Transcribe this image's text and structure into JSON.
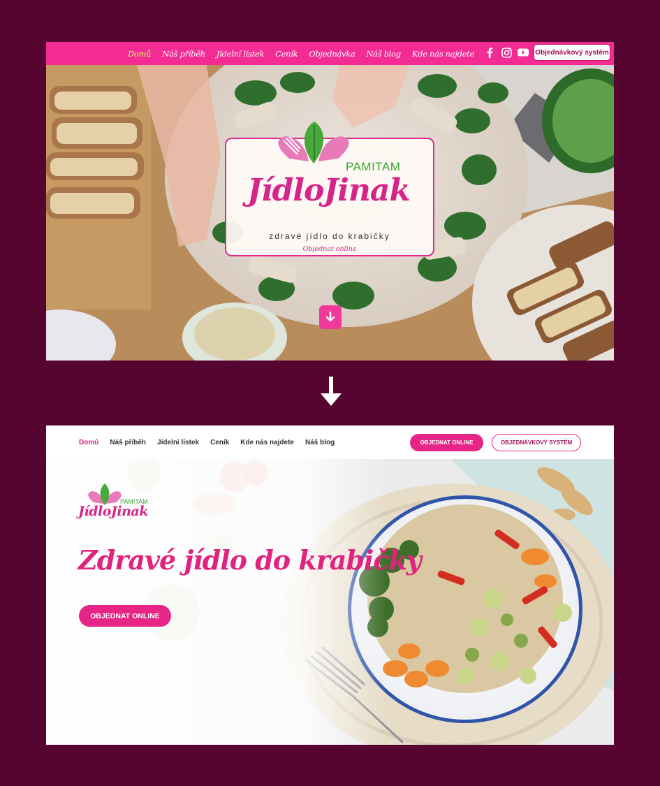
{
  "old_site": {
    "nav": {
      "items": [
        "Domů",
        "Náš příběh",
        "Jídelní lístek",
        "Ceník",
        "Objednávka",
        "Náš blog",
        "Kde nás najdete"
      ],
      "active_index": 0,
      "social_icons": [
        "facebook-icon",
        "instagram-icon",
        "youtube-icon"
      ],
      "system_button": "Objednávkový systém"
    },
    "logo": {
      "pamitam": "PAMITAM",
      "brand": "JídloJinak",
      "tagline": "zdravé jídlo do krabičky",
      "order_link": "Objednat online"
    },
    "scroll_icon": "arrow-down-icon",
    "colors": {
      "nav_bg": "#f22c94",
      "active_nav": "#d9ff6a",
      "brand_pink": "#d6248b",
      "brand_green": "#3aa52f"
    }
  },
  "transition_icon": "arrow-down-icon",
  "new_site": {
    "nav": {
      "items": [
        "Domů",
        "Náš příběh",
        "Jídelní lístek",
        "Ceník",
        "Kde nás najdete",
        "Náš blog"
      ],
      "active_index": 0,
      "order_button": "OBJEDNAT ONLINE",
      "system_button": "OBJEDNÁVKOVÝ SYSTÉM"
    },
    "logo": {
      "pamitam": "PAMITAM",
      "brand": "JídloJinak"
    },
    "headline": "Zdravé jídlo do krabičky",
    "cta_button": "OBJEDNAT ONLINE",
    "colors": {
      "accent": "#e62587",
      "frame_bg": "#560530"
    }
  }
}
